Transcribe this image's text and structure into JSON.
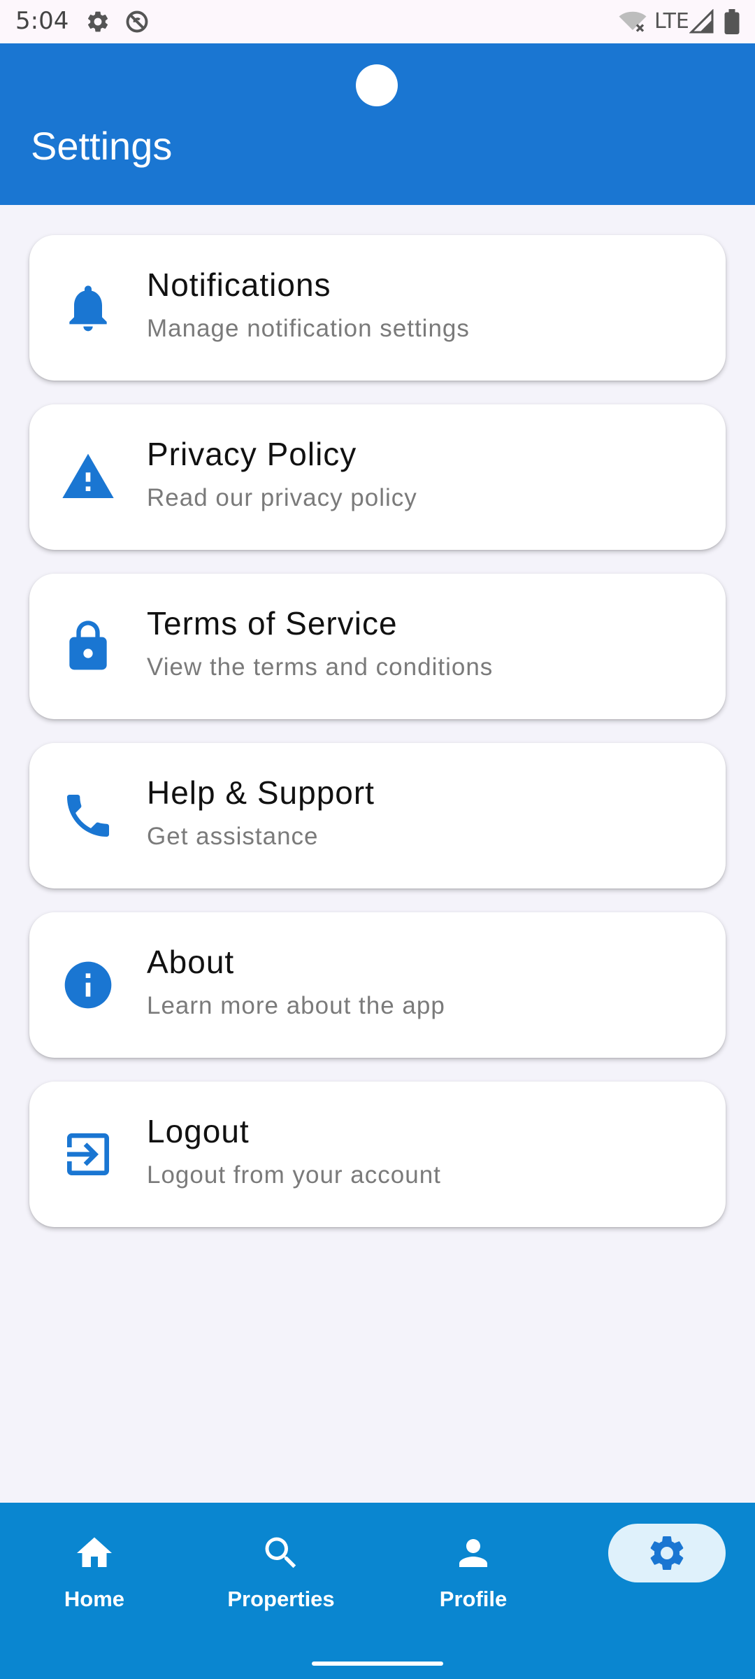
{
  "status_bar": {
    "time": "5:04",
    "network": "LTE",
    "icons": [
      "gear-icon",
      "do-not-disturb-icon",
      "wifi-off-icon",
      "signal-icon",
      "battery-icon"
    ]
  },
  "app_bar": {
    "title": "Settings",
    "color": "#1a76d2"
  },
  "settings": [
    {
      "icon": "bell-icon",
      "title": "Notifications",
      "subtitle": "Manage notification settings"
    },
    {
      "icon": "warning-icon",
      "title": "Privacy Policy",
      "subtitle": "Read our privacy policy"
    },
    {
      "icon": "lock-icon",
      "title": "Terms of Service",
      "subtitle": "View the terms and conditions"
    },
    {
      "icon": "phone-icon",
      "title": "Help & Support",
      "subtitle": "Get assistance"
    },
    {
      "icon": "info-icon",
      "title": "About",
      "subtitle": "Learn more about the app"
    },
    {
      "icon": "logout-icon",
      "title": "Logout",
      "subtitle": "Logout from your account"
    }
  ],
  "bottom_nav": {
    "items": [
      {
        "label": "Home",
        "icon": "home-icon"
      },
      {
        "label": "Properties",
        "icon": "search-icon"
      },
      {
        "label": "Profile",
        "icon": "person-icon"
      },
      {
        "label": "",
        "icon": "gear-icon",
        "selected": true
      }
    ],
    "background": "#0a86d0",
    "accent": "#1a76d2"
  }
}
